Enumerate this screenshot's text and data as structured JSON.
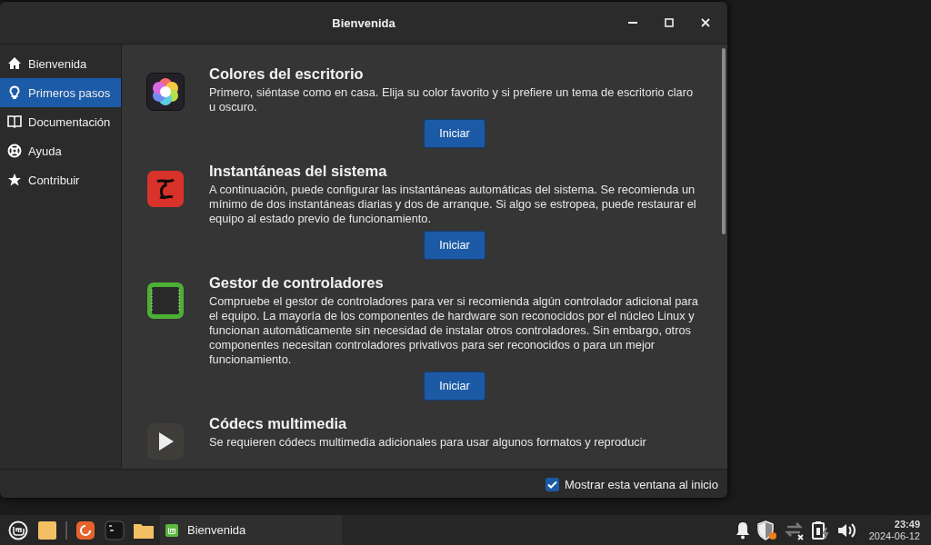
{
  "window": {
    "title": "Bienvenida"
  },
  "sidebar": {
    "items": [
      {
        "kind": "home",
        "label": "Bienvenida",
        "selected": false
      },
      {
        "kind": "bulb",
        "label": "Primeros pasos",
        "selected": true
      },
      {
        "kind": "book",
        "label": "Documentación",
        "selected": false
      },
      {
        "kind": "help",
        "label": "Ayuda",
        "selected": false
      },
      {
        "kind": "star",
        "label": "Contribuir",
        "selected": false
      }
    ]
  },
  "features": [
    {
      "kind": "colors",
      "title": "Colores del escritorio",
      "description": "Primero, siéntase como en casa. Elija su color favorito y si prefiere un tema de escritorio claro u oscuro.",
      "button": "Iniciar"
    },
    {
      "kind": "snapshots",
      "title": "Instantáneas del sistema",
      "description": "A continuación, puede configurar las instantáneas automáticas del sistema. Se recomienda un mínimo de dos instantáneas diarias y dos de arranque. Si algo se estropea, puede restaurar el equipo al estado previo de funcionamiento.",
      "button": "Iniciar"
    },
    {
      "kind": "drivers",
      "title": "Gestor de controladores",
      "description": "Compruebe el gestor de controladores para ver si recomienda algún controlador adicional para el equipo. La mayoría de los componentes de hardware son reconocidos por el núcleo Linux y funcionan automáticamente sin necesidad de instalar otros controladores. Sin embargo, otros componentes necesitan controladores privativos para ser reconocidos o para un mejor funcionamiento.",
      "button": "Iniciar"
    },
    {
      "kind": "codecs",
      "title": "Códecs multimedia",
      "description": "Se requieren códecs multimedia adicionales para usar algunos formatos y reproducir"
    }
  ],
  "footer": {
    "checkbox": {
      "label": "Mostrar esta ventana al inicio",
      "checked": true
    }
  },
  "taskbar": {
    "window_button": {
      "label": "Bienvenida"
    },
    "clock": {
      "time": "23:49",
      "date": "2024-06-12"
    }
  }
}
